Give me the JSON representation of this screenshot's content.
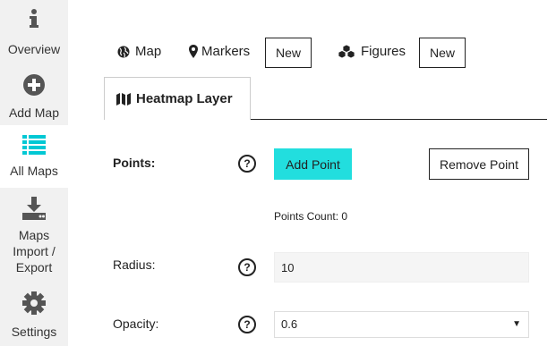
{
  "sidebar": {
    "items": [
      {
        "label": "Overview",
        "icon": "info-icon"
      },
      {
        "label": "Add Map",
        "icon": "plus-circle-icon"
      },
      {
        "label": "All Maps",
        "icon": "list-icon",
        "active": true
      },
      {
        "label": "Maps\nImport /\nExport",
        "icon": "download-icon"
      },
      {
        "label": "Settings",
        "icon": "gear-icon"
      }
    ]
  },
  "tabs": {
    "map": "Map",
    "markers": "Markers",
    "markers_new": "New",
    "figures": "Figures",
    "figures_new": "New",
    "heatmap": "Heatmap Layer"
  },
  "form": {
    "points_label": "Points:",
    "help": "?",
    "add_point": "Add Point",
    "remove_point": "Remove Point",
    "points_count": "Points Count: 0",
    "radius_label": "Radius:",
    "radius_value": "10",
    "opacity_label": "Opacity:",
    "opacity_value": "0.6"
  },
  "colors": {
    "accent": "#22dede",
    "sidebar_bg": "#f1f1f1",
    "list_icon": "#00c8d4"
  }
}
